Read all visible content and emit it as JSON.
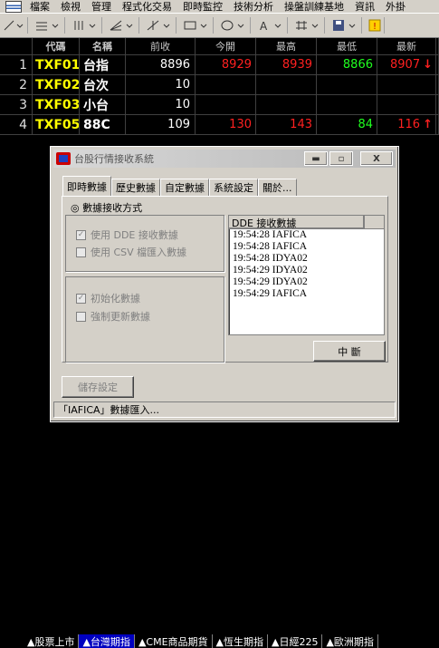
{
  "menu": [
    "檔案",
    "檢視",
    "管理",
    "程式化交易",
    "即時監控",
    "技術分析",
    "操盤訓練基地",
    "資訊",
    "外掛"
  ],
  "table": {
    "headers": [
      "",
      "代碼",
      "名稱",
      "前收",
      "今開",
      "最高",
      "最低",
      "最新"
    ],
    "rows": [
      {
        "idx": "1",
        "code": "TXF01",
        "name": "台指",
        "prev": "8896",
        "open": "8929",
        "high": "8939",
        "low": "8866",
        "last": "8907",
        "arrow": "↓"
      },
      {
        "idx": "2",
        "code": "TXF02",
        "name": "台次",
        "prev": "10",
        "open": "",
        "high": "",
        "low": "",
        "last": "",
        "arrow": ""
      },
      {
        "idx": "3",
        "code": "TXF03",
        "name": "小台",
        "prev": "10",
        "open": "",
        "high": "",
        "low": "",
        "last": "",
        "arrow": ""
      },
      {
        "idx": "4",
        "code": "TXF05",
        "name": "88C",
        "prev": "109",
        "open": "130",
        "high": "143",
        "low": "84",
        "last": "116",
        "arrow": "↑"
      }
    ],
    "colors": {
      "up": "#ff2020",
      "down": "#20ff20",
      "code": "#ffff00"
    }
  },
  "dialog": {
    "title": "台股行情接收系統",
    "min_label": "▬",
    "max_label": "▫",
    "close_label": "X",
    "tabs": [
      "即時數據",
      "歷史數據",
      "自定數據",
      "系統設定",
      "關於..."
    ],
    "mode_label": "◎ 數據接收方式",
    "opt_dde": "使用 DDE 接收數據",
    "opt_csv": "使用 CSV 檔匯入數據",
    "opt_init": "初始化數據",
    "opt_force": "強制更新數據",
    "list_header": "DDE 接收數據",
    "list_rows": [
      "19:54:28  IAFICA",
      "19:54:28  IAFICA",
      "19:54:28  IDYA02",
      "19:54:29  IDYA02",
      "19:54:29  IDYA02",
      "19:54:29  IAFICA"
    ],
    "stop_button": "中 斷",
    "save_button": "儲存設定",
    "status": "「IAFICA」數據匯入..."
  },
  "bottom_tabs": [
    "▲股票上市",
    "▲台灣期指",
    "▲CME商品期貨",
    "▲恆生期指",
    "▲日經225",
    "▲歐洲期指"
  ]
}
